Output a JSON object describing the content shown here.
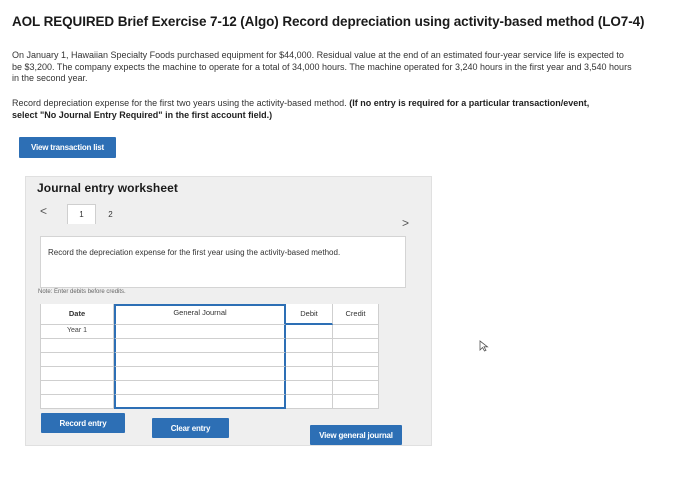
{
  "header": {
    "title": "AOL REQUIRED Brief Exercise 7-12 (Algo) Record depreciation using activity-based method (LO7-4)"
  },
  "problem": {
    "text": "On January 1, Hawaiian Specialty Foods purchased equipment for $44,000. Residual value at the end of an estimated four-year service life is expected to be $3,200. The company expects the machine to operate for a total of 34,000 hours. The machine operated for 3,240 hours in the first year and 3,540 hours in the second year."
  },
  "instruction": {
    "text": "Record depreciation expense for the first two years using the activity-based method.",
    "bold_text": "(If no entry is required for a particular transaction/event, select \"No Journal Entry Required\" in the first account field.)"
  },
  "buttons": {
    "view_transaction_list": "View transaction list",
    "record_entry": "Record entry",
    "clear_entry": "Clear entry",
    "view_general_journal": "View general journal"
  },
  "worksheet": {
    "title": "Journal entry worksheet",
    "pages": [
      "1",
      "2"
    ],
    "active_page": "1",
    "nav_prev": "<",
    "nav_next": ">",
    "description": "Record the depreciation expense for the first year using the activity-based method.",
    "note": "Note: Enter debits before credits."
  },
  "journal": {
    "headers": {
      "date": "Date",
      "account": "General Journal",
      "debit": "Debit",
      "credit": "Credit"
    },
    "rows": [
      {
        "date": "Year 1",
        "account": "",
        "debit": "",
        "credit": ""
      },
      {
        "date": "",
        "account": "",
        "debit": "",
        "credit": ""
      },
      {
        "date": "",
        "account": "",
        "debit": "",
        "credit": ""
      },
      {
        "date": "",
        "account": "",
        "debit": "",
        "credit": ""
      },
      {
        "date": "",
        "account": "",
        "debit": "",
        "credit": ""
      },
      {
        "date": "",
        "account": "",
        "debit": "",
        "credit": ""
      }
    ]
  },
  "colors": {
    "accent": "#2d6fb5",
    "worksheet_bg": "#efefef"
  },
  "icons": {
    "cursor": "mouse-pointer-icon"
  }
}
